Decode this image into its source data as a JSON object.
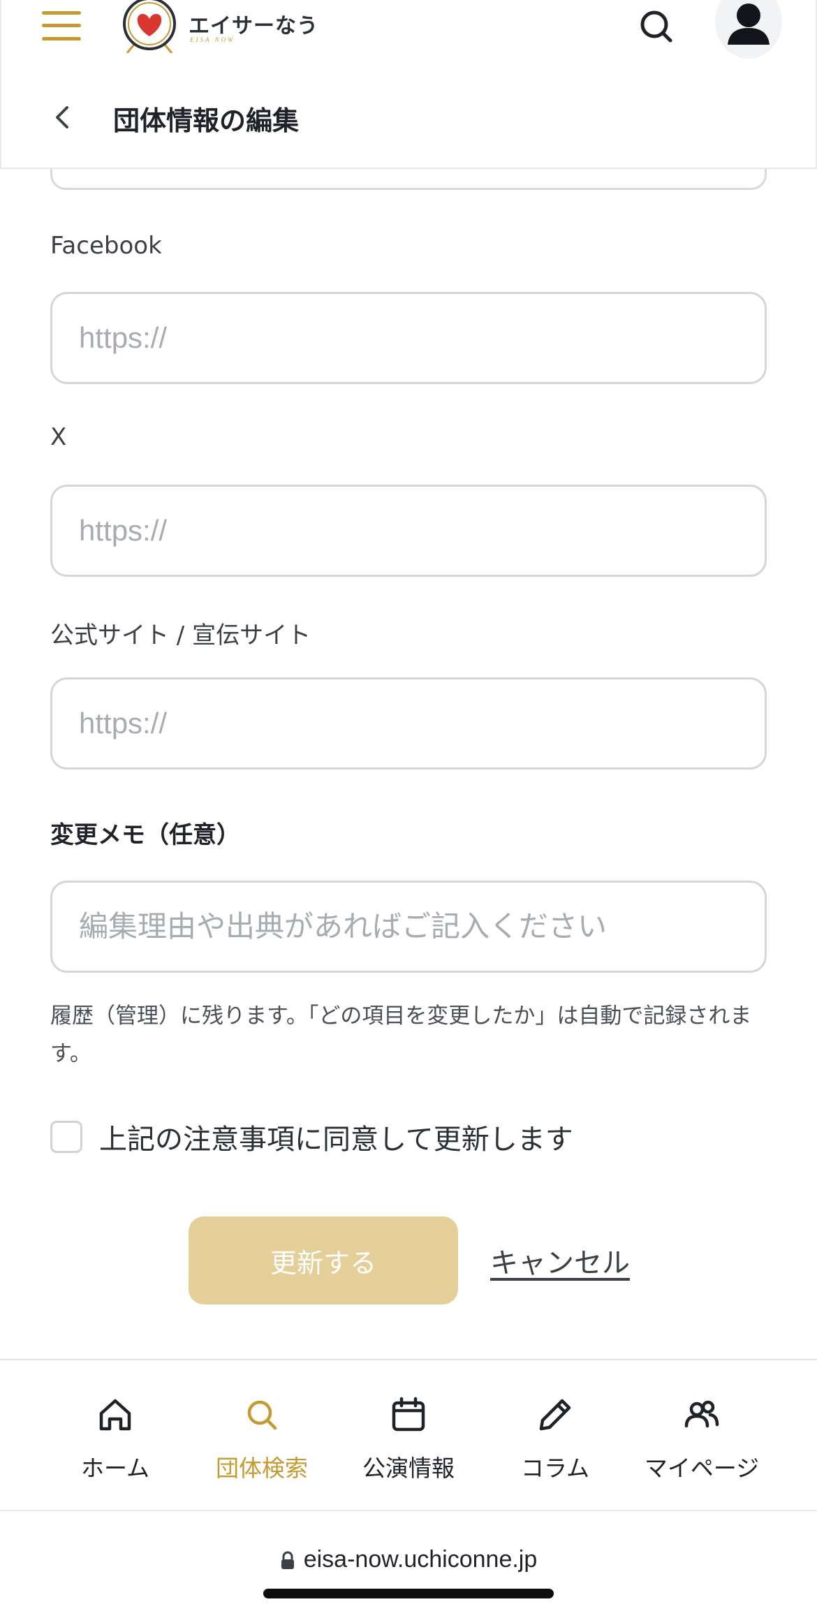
{
  "header": {
    "logo_text": "エイサーなう",
    "logo_sub": "EISA NOW",
    "page_title": "団体情報の編集"
  },
  "colors": {
    "accent": "#c49a32",
    "submit_disabled": "#e5cf98"
  },
  "form": {
    "facebook": {
      "label": "Facebook",
      "placeholder": "https://",
      "value": ""
    },
    "x": {
      "label": "X",
      "placeholder": "https://",
      "value": ""
    },
    "site": {
      "label": "公式サイト / 宣伝サイト",
      "placeholder": "https://",
      "value": ""
    },
    "memo": {
      "label": "変更メモ（任意）",
      "placeholder": "編集理由や出典があればご記入ください",
      "value": ""
    },
    "help_text": "履歴（管理）に残ります。「どの項目を変更したか」は自動で記録されます。",
    "agree_label": "上記の注意事項に同意して更新します",
    "submit_label": "更新する",
    "cancel_label": "キャンセル"
  },
  "bottom_nav": {
    "items": [
      {
        "label": "ホーム",
        "icon": "home-icon"
      },
      {
        "label": "団体検索",
        "icon": "search-icon",
        "active": true
      },
      {
        "label": "公演情報",
        "icon": "calendar-icon"
      },
      {
        "label": "コラム",
        "icon": "pencil-icon"
      },
      {
        "label": "マイページ",
        "icon": "users-icon"
      }
    ]
  },
  "browser": {
    "url": "eisa-now.uchiconne.jp"
  }
}
